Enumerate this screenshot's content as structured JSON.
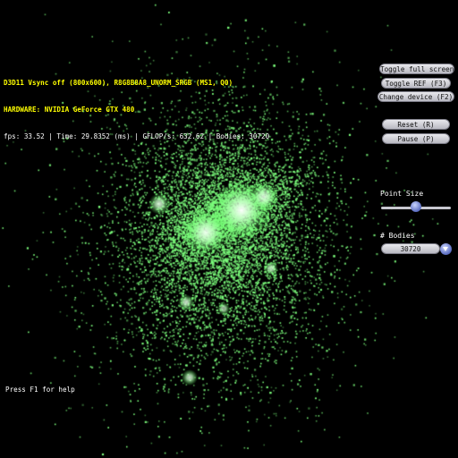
{
  "hud": {
    "line1": "D3D11 Vsync off (800x600), R8G8B8A8_UNORM_SRGB (MS1, Q0)",
    "line2": "HARDWARE: NVIDIA GeForce GTX 480",
    "line3": "fps: 33.52 | Time: 29.8352 (ms) | GFLOP/s: 632.62 | Bodies: 30720",
    "help": "Press F1 for help"
  },
  "controls": {
    "toggle_full_screen": "Toggle full screen",
    "toggle_ref": "Toggle REF (F3)",
    "change_device": "Change device (F2)",
    "reset": "Reset (R)",
    "pause": "Pause (P)",
    "point_size_label": "Point Size",
    "point_size_value": 0.5,
    "bodies_label": "# Bodies",
    "bodies_value": "30720"
  },
  "colors": {
    "particle": "#7dff7d",
    "core": "#eaffea",
    "hud_text": "#ffff00"
  }
}
